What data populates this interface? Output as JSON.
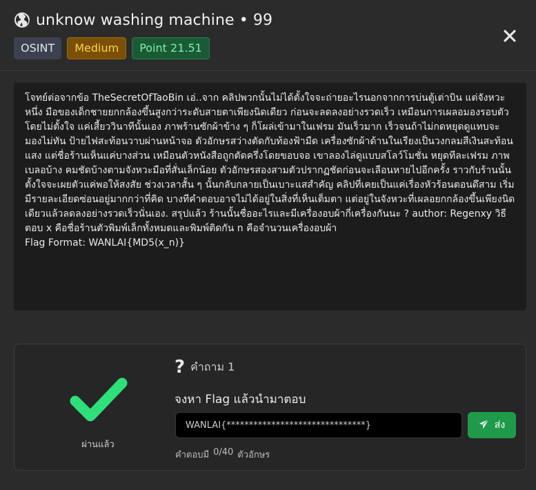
{
  "header": {
    "title": "unknow washing machine • 99",
    "category": "OSINT",
    "difficulty": "Medium",
    "points": "Point 21.51"
  },
  "description": {
    "text": "โจทย์ต่อจากข้อ TheSecretOfTaoBin เอ่..จาก คลิปพวกนั้นไม่ได้ตั้งใจจะถ่ายอะไรนอกจากการบ่นตู้เต่าบิน แต่จังหวะหนึ่ง มือของเด็กชายยกกล้องขึ้นสูงกว่าระดับสายตาเพียงนิดเดียว ก่อนจะลดลงอย่างรวดเร็ว เหมือนการเผลอมองรอบตัวโดยไม่ตั้งใจ แค่เสี้ยววินาทีนั้นเอง ภาพร้านซักผ้าข้าง ๆ ก็โผล่เข้ามาในเฟรม มันเร็วมาก เร็วจนถ้าไม่กดหยุดดูแทบจะมองไม่ทัน ป้ายไฟสะท้อนวาบผ่านหน้าจอ ตัวอักษรสว่างตัดกับท้องฟ้ามืด เครื่องซักผ้าด้านในเรียงเป็นวงกลมสีเงินสะท้อนแสง แต่ชื่อร้านเห็นแค่บางส่วน เหมือนตัวหนังสือถูกตัดครึ่งโดยขอบจอ เขาลองไล่ดูแบบสโลว์โมชั่น หยุดทีละเฟรม ภาพเบลอบ้าง คมชัดบ้างตามจังหวะมือที่สั่นเล็กน้อย ตัวอักษรสองสามตัวปรากฏชัดก่อนจะเลือนหายไปอีกครั้ง ราวกับร้านนั้นตั้งใจจะเผยตัวแค่พอให้สงสัย ช่วงเวลาสั้น ๆ นั้นกลับกลายเป็นเบาะแสสำคัญ คลิปที่เคยเป็นแค่เรื่องหัวร้อนตอนดึสาม เริ่มมีรายละเอียดซ่อนอยู่มากกว่าที่คิด บางทีคำตอบอาจไม่ได้อยู่ในสิ่งที่เห็นเต็มตา แต่อยู่ในจังหวะที่เผลอยกกล้องขึ้นเพียงนิดเดียวแล้วลดลงอย่างรวดเร็วนั่นเอง. สรุปแล้ว ร้านนั้นชื่ออะไรและมีเครื่องอบผ้ากี่เครื่องกันนะ ? author: Regenxy วิธีตอบ x คือชื่อร้านตัวพิมพ์เล็กทั้งหมดและพิมพ์ติดกัน n คือจำนวนเครื่องอบผ้า",
    "flag_format": "Flag Format: WANLAI{MD5(x_n)}"
  },
  "answer": {
    "status": "ผ่านแล้ว",
    "question_label": "คำถาม 1",
    "prompt": "จงหา Flag แล้วนำมาตอบ",
    "input_value": "WANLAI{*******************************}",
    "send_label": "ส่ง",
    "attempts_label": "คำตอบมี",
    "attempts_value": "0/40",
    "attempts_unit": "ตัวอักษร"
  },
  "icons": {
    "globe": "globe-icon",
    "close": "close-icon",
    "check": "check-icon",
    "question": "question-icon",
    "send": "paper-plane-icon"
  },
  "colors": {
    "accent_green": "#1f9a4a",
    "check_green": "#2ee07a",
    "medium_text": "#ffd24d",
    "points_text": "#7ff0a8"
  }
}
